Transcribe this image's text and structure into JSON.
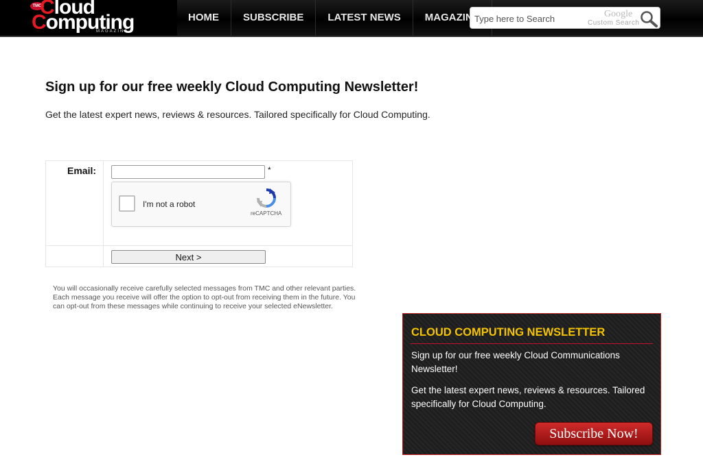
{
  "header": {
    "logo": {
      "badge": "TMC",
      "line1": "Cloud",
      "line2": "Computing",
      "sub": "MAGAZINE"
    },
    "nav": [
      {
        "label": "HOME"
      },
      {
        "label": "SUBSCRIBE"
      },
      {
        "label": "LATEST NEWS"
      },
      {
        "label": "MAGAZINE"
      }
    ],
    "search": {
      "placeholder": "Type here to Search",
      "value": "",
      "google_label": "Google",
      "custom_label": "Custom Search"
    }
  },
  "main": {
    "title": "Sign up for our free weekly Cloud Computing Newsletter!",
    "subtitle": "Get the latest expert news, reviews & resources. Tailored specifically for Cloud Computing.",
    "form": {
      "email_label": "Email:",
      "email_value": "",
      "required_mark": "*",
      "captcha_label": "I'm not a robot",
      "captcha_brand": "reCAPTCHA",
      "next_label": "Next >"
    },
    "disclaimer": "You will occasionally receive carefully selected messages from TMC and other relevant parties. Each message you receive will offer the option to opt-out from receiving them in the future. You can opt-out from these messages while continuing to receive your selected eNewsletter."
  },
  "promo": {
    "title": "CLOUD COMPUTING NEWSLETTER",
    "text1": "Sign up for our free weekly Cloud Communications Newsletter!",
    "text2": "Get the latest expert news, reviews & resources. Tailored specifically for Cloud Computing.",
    "button_label": "Subscribe Now!"
  },
  "colors": {
    "header_bg": "#000000",
    "promo_title": "#f5c400",
    "promo_border": "#cc1b1b",
    "button_red": "#b01c1c"
  },
  "icons": [
    "search-icon",
    "recaptcha-icon"
  ]
}
